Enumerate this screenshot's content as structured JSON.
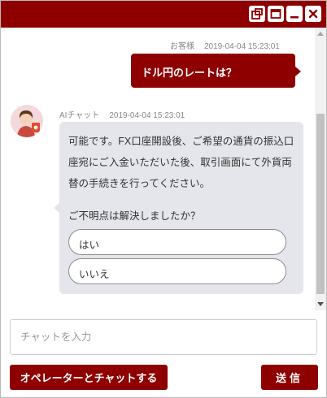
{
  "titlebar": {
    "bg_color": "#8e0000",
    "buttons": [
      {
        "icon": "popout-icon"
      },
      {
        "icon": "maximize-icon"
      },
      {
        "icon": "minimize-icon"
      },
      {
        "icon": "close-icon"
      }
    ]
  },
  "messages": {
    "user": {
      "sender": "お客様",
      "timestamp": "2019-04-04 15:23:01",
      "text": "ドル円のレートは？"
    },
    "bot": {
      "sender": "AIチャット",
      "timestamp": "2019-04-04 15:23:01",
      "text": "可能です。FX口座開設後、ご希望の通貨の振込口座宛にご入金いただいた後、取引画面にて外貨両替の手続きを行ってください。",
      "question": "ご不明点は解決しましたか？",
      "choices": [
        "はい",
        "いいえ"
      ]
    }
  },
  "input": {
    "placeholder": "チャットを入力"
  },
  "buttons": {
    "operator": "オペレーターとチャットする",
    "send": "送信"
  },
  "colors": {
    "accent": "#8e0000",
    "bot_bubble": "#e5e5ec"
  }
}
